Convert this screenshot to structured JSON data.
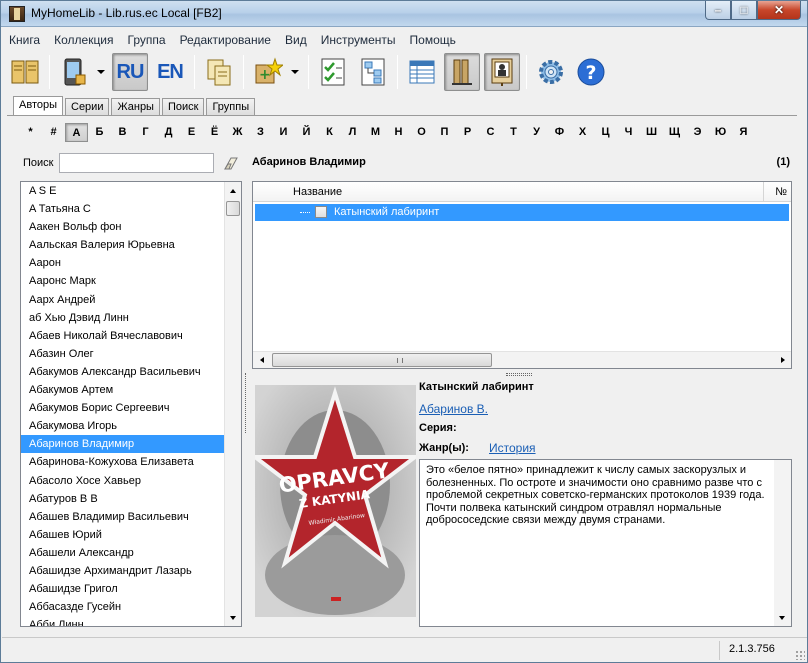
{
  "window": {
    "title": "MyHomeLib - Lib.rus.ec Local [FB2]"
  },
  "menu": [
    "Книга",
    "Коллекция",
    "Группа",
    "Редактирование",
    "Вид",
    "Инструменты",
    "Помощь"
  ],
  "toolbar": {
    "lang_ru": "RU",
    "lang_en": "EN"
  },
  "tabs": [
    "Авторы",
    "Серии",
    "Жанры",
    "Поиск",
    "Группы"
  ],
  "alphabet": [
    "*",
    "#",
    "А",
    "Б",
    "В",
    "Г",
    "Д",
    "Е",
    "Ё",
    "Ж",
    "З",
    "И",
    "Й",
    "К",
    "Л",
    "М",
    "Н",
    "О",
    "П",
    "Р",
    "С",
    "Т",
    "У",
    "Ф",
    "Х",
    "Ц",
    "Ч",
    "Ш",
    "Щ",
    "Э",
    "Ю",
    "Я"
  ],
  "active_letter": "А",
  "search": {
    "label": "Поиск",
    "value": ""
  },
  "authors": [
    "A S E",
    "A Татьяна С",
    "Аакен Вольф фон",
    "Аальская Валерия Юрьевна",
    "Аарон",
    "Ааронс Марк",
    "Аарх Андрей",
    "аб Хью Дэвид Линн",
    "Абаев Николай Вячеславович",
    "Абазин Олег",
    "Абакумов Александр Васильевич",
    "Абакумов Артем",
    "Абакумов Борис Сергеевич",
    "Абакумова Игорь",
    "Абаринов Владимир",
    "Абаринова-Кожухова Елизавета",
    "Абасоло Хосе Хавьер",
    "Абатуров В В",
    "Абашев Владимир Васильевич",
    "Абашев Юрий",
    "Абашели Александр",
    "Абашидзе Архимандрит Лазарь",
    "Абашидзе Григол",
    "Аббасазде Гусейн",
    "Абби Линн"
  ],
  "selected_author": "Абаринов Владимир",
  "books_panel": {
    "author": "Абаринов Владимир",
    "count": "(1)",
    "col_title": "Название",
    "col_num": "№",
    "rows": [
      {
        "title": "Катынский лабиринт"
      }
    ]
  },
  "book_info": {
    "title": "Катынский лабиринт",
    "author": "Абаринов В.",
    "series_label": "Серия:",
    "genre_label": "Жанр(ы):",
    "genre": "История",
    "annotation": "Это «белое пятно» принадлежит к числу самых заскорузлых и болезненных. По остроте и значимости оно сравнимо разве что с проблемой секретных советско-германских протоколов 1939 года. Почти полвека катынский синдром отравлял нормальные добрососедские связи между двумя странами.",
    "cover": {
      "title_line1": "OPRAVCY",
      "title_line2": "Z KATYNIA",
      "author_line": "Władimir Abarinow",
      "star_color": "#b3252c"
    }
  },
  "status": {
    "version": "2.1.3.756"
  }
}
